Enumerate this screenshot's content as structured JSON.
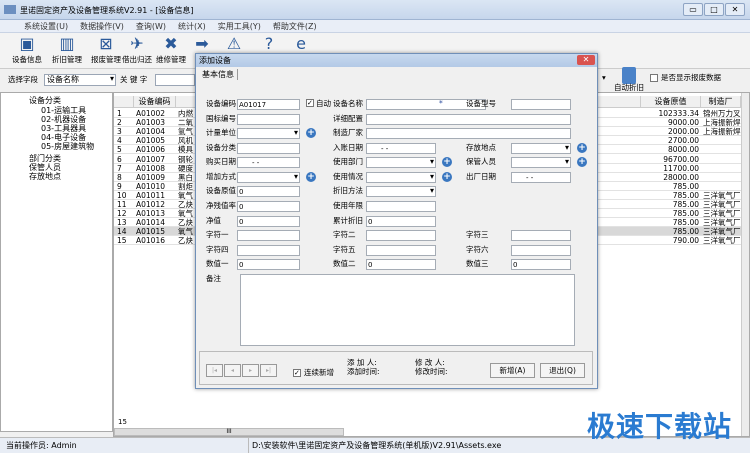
{
  "window": {
    "title": "里诺固定资产及设备管理系统V2.91 - [设备信息]",
    "min": "▭",
    "max": "□",
    "close": "✕"
  },
  "menu": [
    "系统设置(U)",
    "数据操作(V)",
    "查询(W)",
    "统计(X)",
    "实用工具(Y)",
    "帮助文件(Z)"
  ],
  "toolbar": [
    {
      "label": "设备信息",
      "icon": "monitor-icon",
      "glyph": "▣"
    },
    {
      "label": "折旧管理",
      "icon": "chart-icon",
      "glyph": "▥"
    },
    {
      "label": "报废管理",
      "icon": "scrap-icon",
      "glyph": "⊠"
    },
    {
      "label": "借出归还",
      "icon": "runner-icon",
      "glyph": "✈"
    },
    {
      "label": "维修管理",
      "icon": "tools-icon",
      "glyph": "✖"
    },
    {
      "label": "转",
      "icon": "arrow-icon",
      "glyph": "➡"
    },
    {
      "label": "",
      "icon": "warning-icon",
      "glyph": "⚠"
    },
    {
      "label": "",
      "icon": "help-icon",
      "glyph": "?"
    },
    {
      "label": "",
      "icon": "ie-icon",
      "glyph": "e"
    }
  ],
  "search": {
    "field_label": "选择字段",
    "field_value": "设备名称",
    "keyword_label": "关 键 字",
    "auto_depr": "自动折旧",
    "show_scrap": "是否显示报废数据"
  },
  "tree": {
    "root": "设备分类",
    "children": [
      "01-运输工具",
      "02-机器设备",
      "03-工具器具",
      "04-电子设备",
      "05-房屋建筑物"
    ],
    "others": [
      "部门分类",
      "保管人员",
      "存放地点"
    ]
  },
  "grid": {
    "headers": {
      "code": "设备编码",
      "value": "设备原值",
      "maker": "制造厂"
    },
    "rows": [
      {
        "n": "1",
        "code": "A01002",
        "name": "内燃",
        "value": "102333.34",
        "maker": "锦州万力叉车厂"
      },
      {
        "n": "2",
        "code": "A01003",
        "name": "二氧",
        "value": "9000.00",
        "maker": "上海振新焊割机"
      },
      {
        "n": "3",
        "code": "A01004",
        "name": "氩气",
        "value": "2000.00",
        "maker": "上海振新焊割机"
      },
      {
        "n": "4",
        "code": "A01005",
        "name": "风机",
        "value": "2700.00",
        "maker": ""
      },
      {
        "n": "5",
        "code": "A01006",
        "name": "模具",
        "value": "8000.00",
        "maker": ""
      },
      {
        "n": "6",
        "code": "A01007",
        "name": "钢轮",
        "value": "96700.00",
        "maker": ""
      },
      {
        "n": "7",
        "code": "A01008",
        "name": "硬度",
        "value": "11700.00",
        "maker": ""
      },
      {
        "n": "8",
        "code": "A01009",
        "name": "黑白",
        "value": "28000.00",
        "maker": ""
      },
      {
        "n": "9",
        "code": "A01010",
        "name": "割炬",
        "value": "785.00",
        "maker": ""
      },
      {
        "n": "10",
        "code": "A01011",
        "name": "氧气",
        "value": "785.00",
        "maker": "三洋氧气厂"
      },
      {
        "n": "11",
        "code": "A01012",
        "name": "乙炔",
        "value": "785.00",
        "maker": "三洋氧气厂"
      },
      {
        "n": "12",
        "code": "A01013",
        "name": "氧气",
        "value": "785.00",
        "maker": "三洋氧气厂"
      },
      {
        "n": "13",
        "code": "A01014",
        "name": "乙炔",
        "value": "785.00",
        "maker": "三洋氧气厂"
      },
      {
        "n": "14",
        "code": "A01015",
        "name": "氧气",
        "value": "785.00",
        "maker": "三洋氧气厂"
      },
      {
        "n": "15",
        "code": "A01016",
        "name": "乙炔",
        "value": "790.00",
        "maker": "三洋氧气厂"
      }
    ],
    "footer_row": "15",
    "hscroll": "III"
  },
  "dialog": {
    "title": "添加设备",
    "tab": "基本信息",
    "close": "✕",
    "fields": {
      "code": "设备编码",
      "code_value": "A01017",
      "auto": "自动",
      "name": "设备名称",
      "required": "*",
      "model": "设备型号",
      "gb": "国标编号",
      "config": "详细配置",
      "unit": "计量单位",
      "maker": "制造厂家",
      "category": "设备分类",
      "entry_date": "入账日期",
      "location": "存放地点",
      "buy_date": "购买日期",
      "dept": "使用部门",
      "keeper": "保管人员",
      "add_method": "增加方式",
      "usage": "使用情况",
      "factory_date": "出厂日期",
      "orig_value": "设备原值",
      "orig_value_v": "0",
      "depr_method": "折旧方法",
      "residual": "净残值率",
      "residual_v": "0",
      "years": "使用年限",
      "net": "净值",
      "net_v": "0",
      "acc_depr": "累计折旧",
      "acc_depr_v": "0",
      "s1": "字符一",
      "s2": "字符二",
      "s3": "字符三",
      "s4": "字符四",
      "s5": "字符五",
      "s6": "字符六",
      "n1": "数值一",
      "n1_v": "0",
      "n2": "数值二",
      "n2_v": "0",
      "n3": "数值三",
      "n3_v": "0",
      "remark": "备注",
      "date_ph": "-  -"
    },
    "bottom": {
      "continue": "连续新增",
      "adder": "添 加 人:",
      "add_time": "添加时间:",
      "modifier": "修 改 人:",
      "mod_time": "修改时间:",
      "new": "新增(A)",
      "exit": "退出(Q)",
      "nav": [
        "|◂",
        "◂",
        "▸",
        "▸|"
      ]
    }
  },
  "status": {
    "operator": "当前操作员: Admin",
    "path": "D:\\安装软件\\里诺固定资产及设备管理系统(单机版)V2.91\\Assets.exe"
  },
  "watermark": "极速下载站"
}
